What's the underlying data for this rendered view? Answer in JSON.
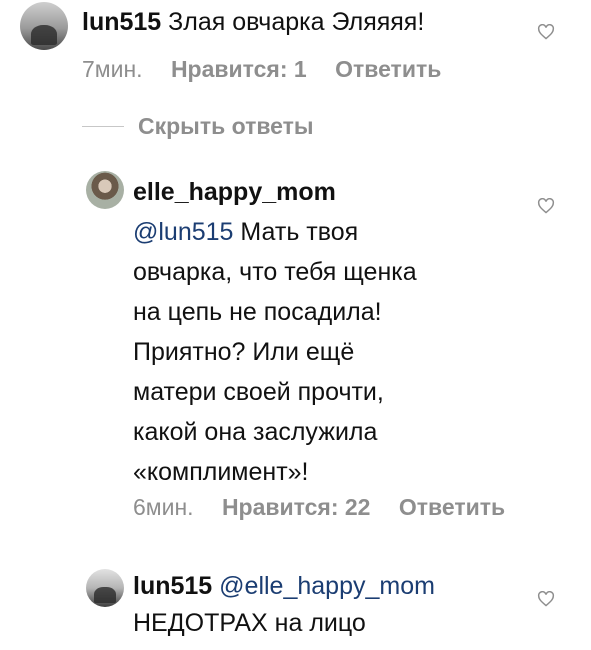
{
  "comments": [
    {
      "username": "lun515",
      "text": "Злая овчарка Эляяяя!",
      "time": "7мин.",
      "likes": "Нравится: 1",
      "reply": "Ответить"
    },
    {
      "username": "elle_happy_mom",
      "mention": "@lun515",
      "lines": [
        "Мать твоя",
        "овчарка, что тебя щенка",
        "на цепь не посадила!",
        "Приятно? Или ещё",
        "матери своей прочти,",
        "какой она заслужила",
        "«комплимент»!"
      ],
      "time": "6мин.",
      "likes": "Нравится: 22",
      "reply": "Ответить"
    },
    {
      "username": "lun515",
      "mention": "@elle_happy_mom",
      "text": "НЕДОТРАХ на лицо"
    }
  ],
  "hide_replies": "Скрыть ответы",
  "icons": {
    "heart": "heart-outline-icon"
  },
  "colors": {
    "meta": "#8e8e8e",
    "mention": "#1b3d72"
  }
}
